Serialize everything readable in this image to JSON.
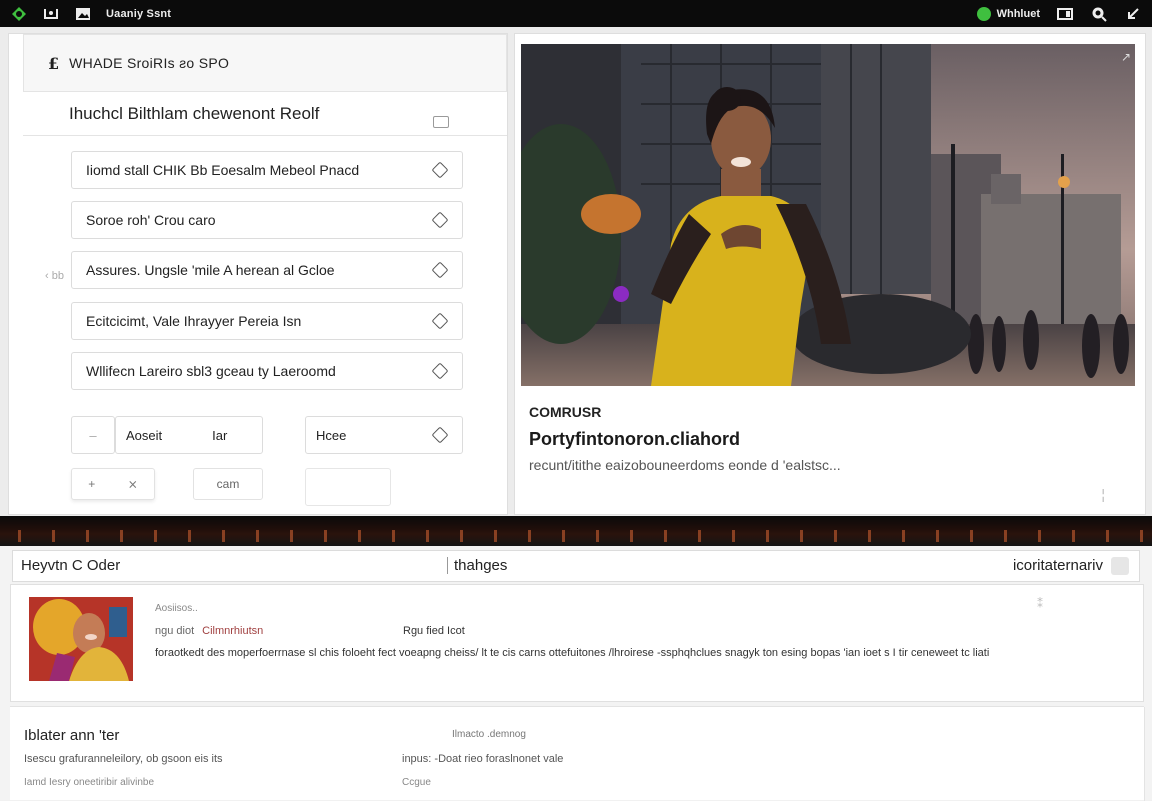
{
  "topbar": {
    "title": "Uaaniy Ssnt",
    "user_name": "Whhluet"
  },
  "left_panel": {
    "currency_symbol": "£",
    "header": "WHADE SroiRIs ƨo SPO",
    "section_title": "Ihuchcl Bilthlam chewenont Reolf",
    "back_label": "‹ bb",
    "options": [
      "Iiomd stall CHIK Bb Eoesalm  Mebeol  Pnacd",
      "Soroe roh' Crou caro",
      "Assures. Ungsle 'mile  A herean al Gcloe",
      "Ecitcicimt, Vale Ihrayyer Pereia Isn",
      "Wllifecn  Lareiro sbl3 gceau ty Laeroomd"
    ],
    "asset_label": "Aoseit",
    "asset_value": "Iar",
    "dec_label": "Hcee",
    "minus_label": "–",
    "plus_label": "+",
    "x_label": "⨯",
    "cam_label": "cam"
  },
  "feature": {
    "kicker": "COMRUSR",
    "title": "Portyfintonoron.cliahord",
    "description": "recunt/itithe eaizobouneerdoms eonde d 'ealstsc...",
    "mark": "¦"
  },
  "lower": {
    "tabs": [
      "Heyvtn  C Oder",
      "thahges",
      "icoritaternariv"
    ],
    "card": {
      "label": "Aosiisos..",
      "sub1": "ngu diot",
      "sub1_highlight": "Cilmnrhiutsn",
      "sub2": "Rgu fied Icot",
      "body": "foraotkedt des moperfoerrnase sl chis foloeht  fect voeapng cheiss/ lt  te cis carns ottefuitones /lhroirese -ssphqhclues snagyk ton esing bopas 'ian ioet s I tir  ceneweet tc liati",
      "more": "⁑"
    },
    "section2": {
      "title": "Iblater ann 'ter",
      "subtitle": "Ilmacto  .demnog",
      "row1a": "Isescu grafuranneleilory, ob gsoon eis  its",
      "row1b": "inpus: -Doat rieo foraslnonet  vale",
      "row2a": "Iamd Iesry   oneetiribir alivinbe",
      "row2b": "Ccgue"
    }
  },
  "colors": {
    "status_online": "#3fbf3f",
    "top_bar": "#0b0b0b",
    "shirt_yellow": "#d8b21c"
  },
  "icons": [
    "app-logo-icon",
    "user-icon",
    "image-icon",
    "status-online-icon",
    "window-icon",
    "search-icon",
    "back-arrow-icon",
    "pound-currency-icon",
    "card-icon",
    "radio-diamond-icon",
    "expand-icon"
  ]
}
